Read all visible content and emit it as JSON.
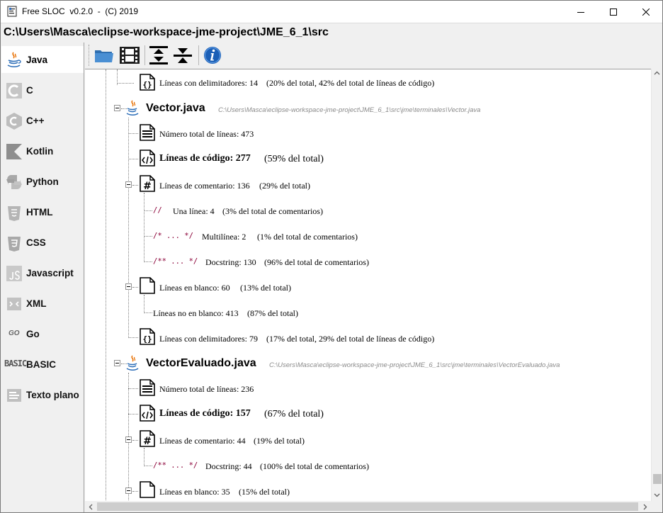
{
  "window": {
    "title": "Free SLOC  v0.2.0  -  (C) 2019",
    "path": "C:\\Users\\Masca\\eclipse-workspace-jme-project\\JME_6_1\\src"
  },
  "sidebar": {
    "items": [
      {
        "label": "Java",
        "icon": "java-icon"
      },
      {
        "label": "C",
        "icon": "c-icon"
      },
      {
        "label": "C++",
        "icon": "cpp-icon"
      },
      {
        "label": "Kotlin",
        "icon": "kotlin-icon"
      },
      {
        "label": "Python",
        "icon": "python-icon"
      },
      {
        "label": "HTML",
        "icon": "html5-icon"
      },
      {
        "label": "CSS",
        "icon": "css3-icon"
      },
      {
        "label": "Javascript",
        "icon": "js-icon"
      },
      {
        "label": "XML",
        "icon": "xml-icon"
      },
      {
        "label": "Go",
        "icon": "go-icon",
        "badge": "GO"
      },
      {
        "label": "BASIC",
        "icon": "basic-icon",
        "badge": "BASIC"
      },
      {
        "label": "Texto plano",
        "icon": "text-file-icon"
      }
    ]
  },
  "toolbar": {
    "buttons": [
      "open-folder-icon",
      "film-icon",
      "expand-all-icon",
      "collapse-all-icon",
      "info-icon"
    ]
  },
  "tree": {
    "top": {
      "delim": "Líneas con delimitadores: 14",
      "delim_pct": "(20% del total, 42% del total de líneas de código)"
    },
    "files": [
      {
        "name": "Vector.java",
        "path": "C:\\Users\\Masca\\eclipse-workspace-jme-project\\JME_6_1\\src\\jme\\terminales\\Vector.java",
        "total": "Número total de líneas: 473",
        "code": "Líneas de código: 277",
        "code_pct": "(59% del total)",
        "comments": "Líneas de comentario: 136",
        "comments_pct": "(29% del total)",
        "single_sym": "//",
        "single": "Una línea: 4",
        "single_pct": "(3% del total de comentarios)",
        "multi_sym": "/* ... */",
        "multi": "Multilínea: 2",
        "multi_pct": "(1% del total de comentarios)",
        "doc_sym": "/** ... */",
        "doc": "Docstring: 130",
        "doc_pct": "(96% del total de comentarios)",
        "blank": "Líneas en blanco: 60",
        "blank_pct": "(13% del total)",
        "nonblank": "Líneas no en blanco: 413",
        "nonblank_pct": "(87% del total)",
        "delim": "Líneas con delimitadores: 79",
        "delim_pct": "(17% del total, 29% del total de líneas de código)"
      },
      {
        "name": "VectorEvaluado.java",
        "path": "C:\\Users\\Masca\\eclipse-workspace-jme-project\\JME_6_1\\src\\jme\\terminales\\VectorEvaluado.java",
        "total": "Número total de líneas: 236",
        "code": "Líneas de código: 157",
        "code_pct": "(67% del total)",
        "comments": "Líneas de comentario: 44",
        "comments_pct": "(19% del total)",
        "doc_sym": "/** ... */",
        "doc": "Docstring: 44",
        "doc_pct": "(100% del total de comentarios)",
        "blank": "Líneas en blanco: 35",
        "blank_pct": "(15% del total)"
      }
    ]
  }
}
